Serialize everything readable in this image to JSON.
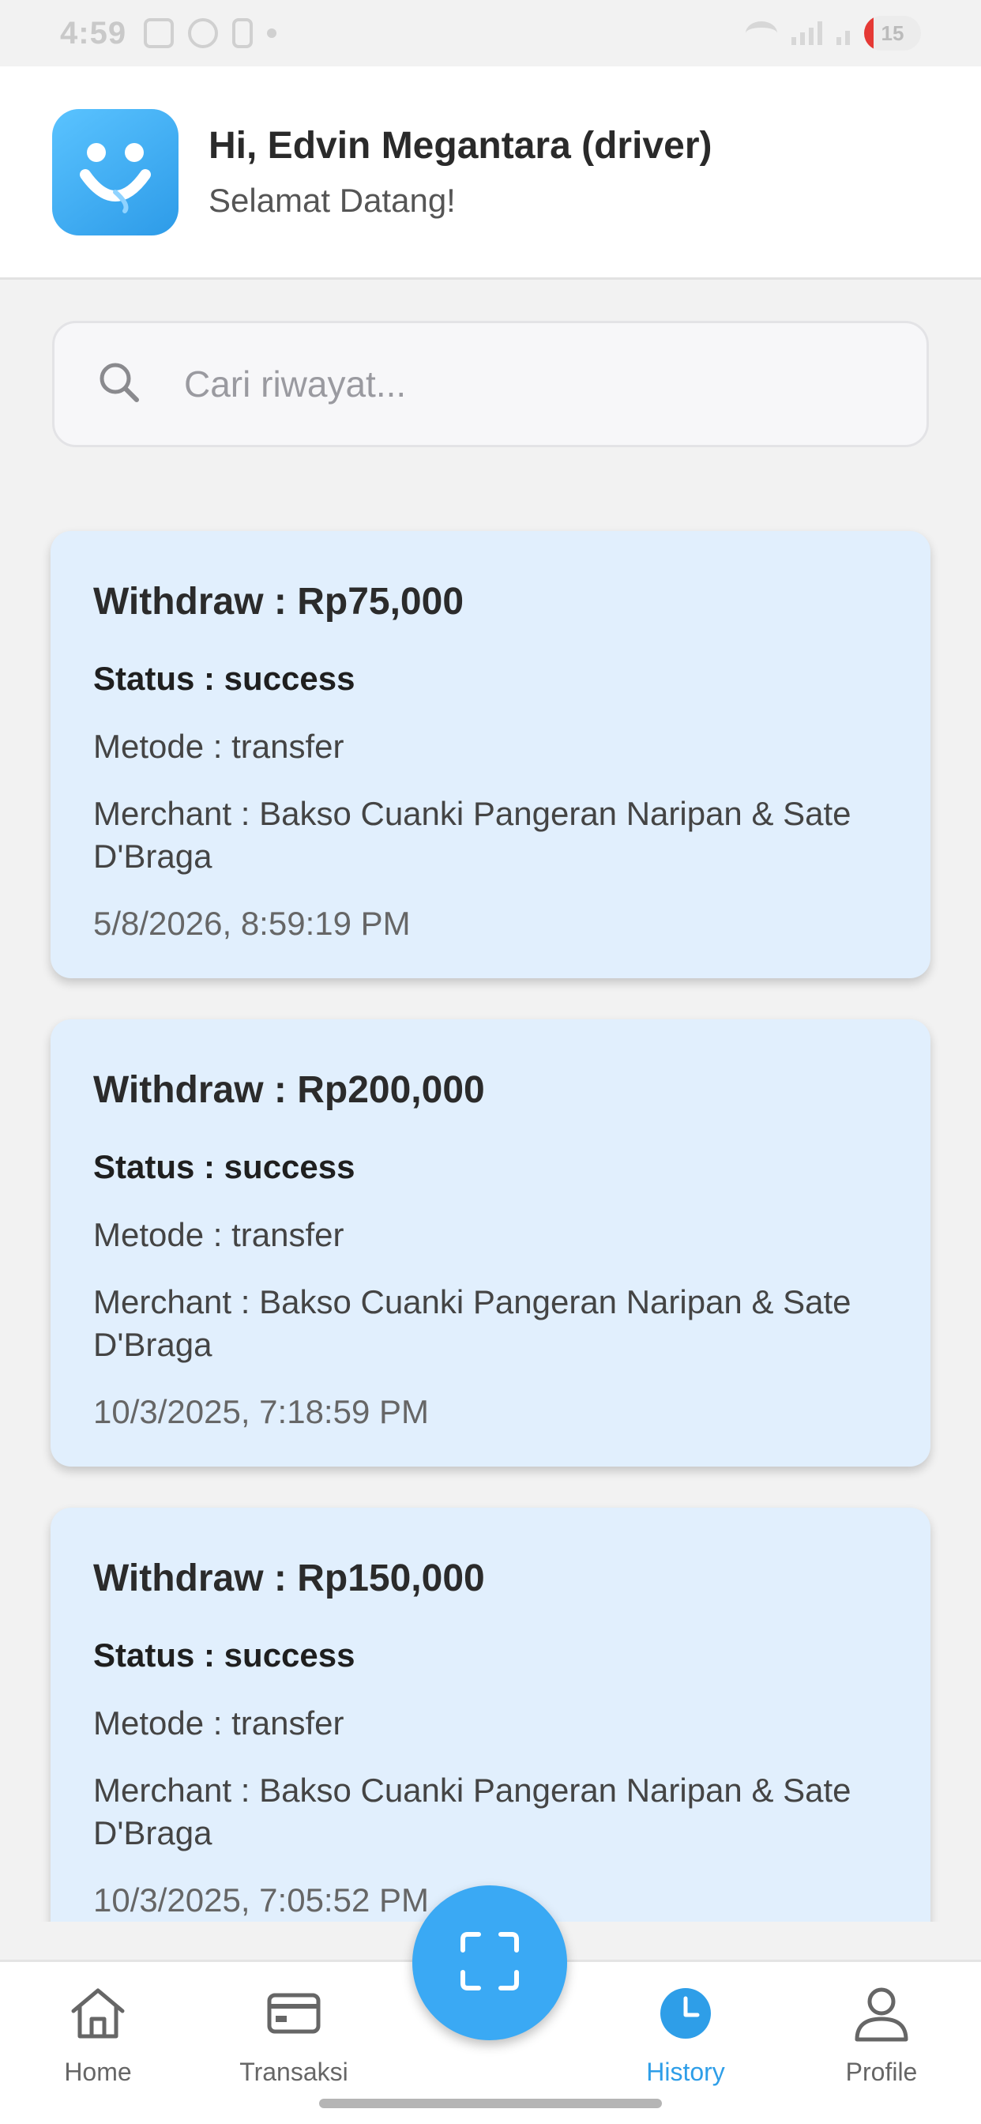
{
  "status_bar": {
    "time": "4:59",
    "battery_level": "15"
  },
  "header": {
    "greeting": "Hi, Edvin Megantara (driver)",
    "welcome": "Selamat Datang!"
  },
  "search": {
    "placeholder": "Cari riwayat..."
  },
  "history": [
    {
      "title": "Withdraw : Rp75,000",
      "status": "Status : success",
      "method": "Metode : transfer",
      "merchant": "Merchant : Bakso Cuanki Pangeran Naripan & Sate D'Braga",
      "date": "5/8/2026, 8:59:19 PM"
    },
    {
      "title": "Withdraw : Rp200,000",
      "status": "Status : success",
      "method": "Metode : transfer",
      "merchant": "Merchant : Bakso Cuanki Pangeran Naripan & Sate D'Braga",
      "date": "10/3/2025, 7:18:59 PM"
    },
    {
      "title": "Withdraw : Rp150,000",
      "status": "Status : success",
      "method": "Metode : transfer",
      "merchant": "Merchant : Bakso Cuanki Pangeran Naripan & Sate D'Braga",
      "date": "10/3/2025, 7:05:52 PM"
    }
  ],
  "nav": {
    "home": "Home",
    "transaksi": "Transaksi",
    "history": "History",
    "profile": "Profile",
    "active": "history"
  },
  "icons": {
    "logo": "smile-logo-icon",
    "search": "search-icon",
    "scan": "scan-icon",
    "home": "home-icon",
    "transaksi": "card-icon",
    "history": "clock-icon",
    "profile": "user-icon"
  },
  "colors": {
    "accent": "#3aa9f4",
    "card_bg": "#e1effd",
    "page_bg": "#f2f2f2"
  }
}
